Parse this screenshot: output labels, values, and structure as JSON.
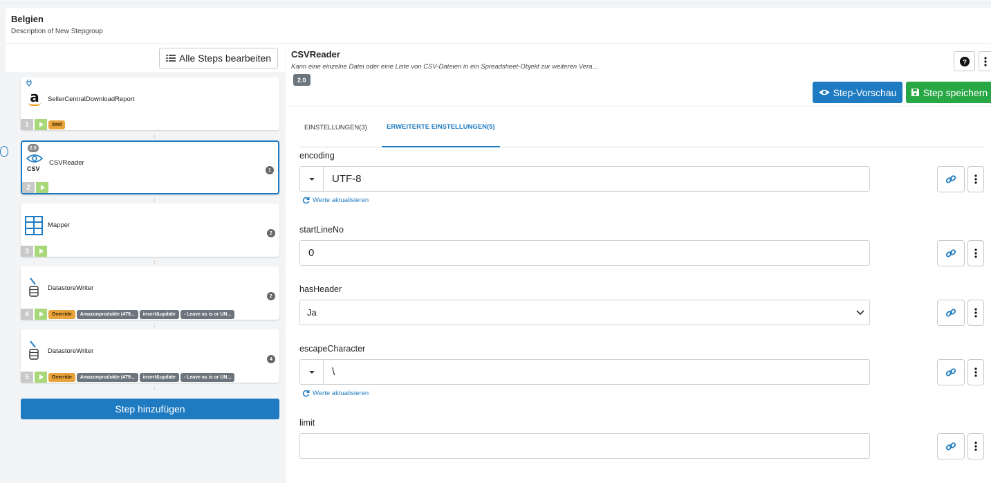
{
  "group": {
    "title": "Belgien",
    "description": "Description of New Stepgroup"
  },
  "left": {
    "edit_all_label": "Alle Steps bearbeiten",
    "add_step_label": "Step hinzufügen",
    "steps": [
      {
        "num": "1",
        "name": "SellerCentralDownloadReport",
        "icon": "amazon-icon",
        "tags": [
          "limit"
        ],
        "count": ""
      },
      {
        "num": "2",
        "name": "CSVReader",
        "icon": "csv-eye-icon",
        "version": "2.0",
        "icon_label": "CSV",
        "count": "1",
        "tags": []
      },
      {
        "num": "3",
        "name": "Mapper",
        "icon": "table-icon",
        "count": "2",
        "tags": []
      },
      {
        "num": "4",
        "name": "DatastoreWriter",
        "icon": "database-pen-icon",
        "count": "2",
        "tags": [
          "Override",
          "Amazonprodukte (479...",
          "insert&update",
          "- Leave as is or UN..."
        ]
      },
      {
        "num": "5",
        "name": "DatastoreWriter",
        "icon": "database-pen-icon",
        "count": "4",
        "tags": [
          "Override",
          "Amazonprodukte (479...",
          "insert&update",
          "- Leave as is or UN..."
        ]
      }
    ]
  },
  "detail": {
    "title": "CSVReader",
    "description": "Kann eine einzelne Datei oder eine Liste von CSV-Dateien in ein Spreadsheet-Objekt zur weiteren Vera...",
    "version": "2.0",
    "preview_label": "Step-Vorschau",
    "save_label": "Step speichern",
    "tabs": [
      {
        "label": "EINSTELLUNGEN(3)",
        "active": false
      },
      {
        "label": "ERWEITERTE EINSTELLUNGEN(5)",
        "active": true
      }
    ],
    "refresh_label": "Werte aktualisieren",
    "fields": [
      {
        "label": "encoding",
        "value": "UTF-8",
        "type": "combo"
      },
      {
        "label": "startLineNo",
        "value": "0",
        "type": "text"
      },
      {
        "label": "hasHeader",
        "value": "Ja",
        "type": "select"
      },
      {
        "label": "escapeCharacter",
        "value": "\\",
        "type": "combo"
      },
      {
        "label": "limit",
        "value": "",
        "type": "text"
      }
    ]
  },
  "colors": {
    "primary": "#1f7bc1",
    "success": "#28a745",
    "warning": "#e8a33c",
    "muted": "#6c757d"
  }
}
